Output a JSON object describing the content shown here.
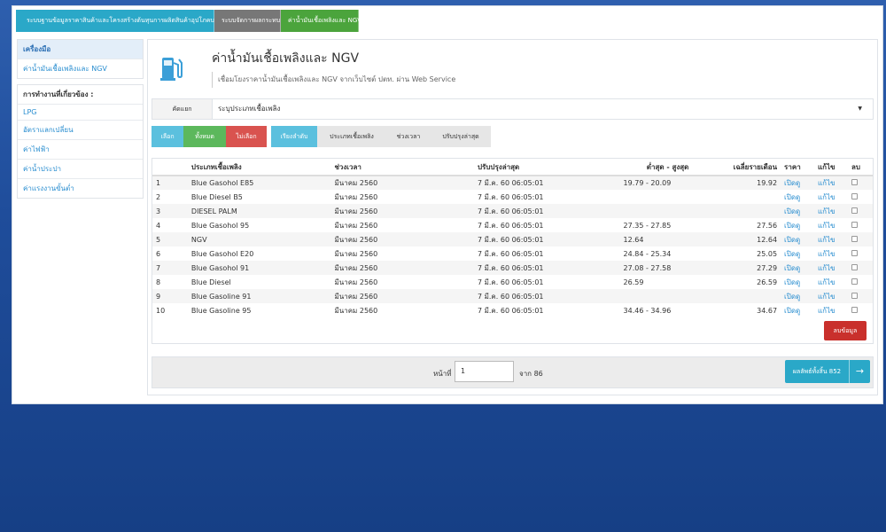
{
  "topnav": {
    "tabs": [
      {
        "label": "ระบบฐานข้อมูลราคาสินค้าและโครงสร้างต้นทุนการผลิตสินค้าอุปโภคบริโภค"
      },
      {
        "label": "ระบบจัดการผลกระทบ"
      },
      {
        "label": "ค่าน้ำมันเชื้อเพลิงและ NGV"
      }
    ]
  },
  "sidebar": {
    "tools_title": "เครื่องมือ",
    "tools_items": [
      "ค่าน้ำมันเชื้อเพลิงและ NGV"
    ],
    "related_title": "การทำงานที่เกี่ยวข้อง :",
    "related_items": [
      "LPG",
      "อัตราแลกเปลี่ยน",
      "ค่าไฟฟ้า",
      "ค่าน้ำประปา",
      "ค่าแรงงานขั้นต่ำ"
    ]
  },
  "main": {
    "title": "ค่าน้ำมันเชื้อเพลิงและ NGV",
    "subtitle": "เชื่อมโยงราคาน้ำมันเชื้อเพลิงและ NGV จากเว็บไซต์ ปตท. ผ่าน Web Service",
    "filter_label": "คัดแยก",
    "filter_value": "ระบุประเภทเชื้อเพลิง",
    "buttons": {
      "select": "เลือก",
      "all": "ทั้งหมด",
      "none": "ไม่เลือก",
      "sort": "เรียงลำดับ",
      "type": "ประเภทเชื้อเพลิง",
      "period": "ช่วงเวลา",
      "updated": "ปรับปรุงล่าสุด"
    },
    "delete_label": "ลบข้อมูล"
  },
  "table": {
    "headers": {
      "no": "",
      "type": "ประเภทเชื้อเพลิง",
      "period": "ช่วงเวลา",
      "updated": "ปรับปรุงล่าสุด",
      "range": "ต่ำสุด - สูงสุด",
      "avg": "เฉลี่ยรายเดือน",
      "price": "ราคา",
      "edit": "แก้ไข",
      "delete": "ลบ"
    },
    "rows": [
      {
        "no": "1",
        "type": "Blue Gasohol E85",
        "period": "มีนาคม 2560",
        "updated": "7 มี.ค. 60 06:05:01",
        "range": "19.79 - 20.09",
        "avg": "19.92",
        "price": "เปิดดู",
        "edit": "แก้ไข"
      },
      {
        "no": "2",
        "type": "Blue Diesel B5",
        "period": "มีนาคม 2560",
        "updated": "7 มี.ค. 60 06:05:01",
        "range": "",
        "avg": "",
        "price": "เปิดดู",
        "edit": "แก้ไข"
      },
      {
        "no": "3",
        "type": "DIESEL PALM",
        "period": "มีนาคม 2560",
        "updated": "7 มี.ค. 60 06:05:01",
        "range": "",
        "avg": "",
        "price": "เปิดดู",
        "edit": "แก้ไข"
      },
      {
        "no": "4",
        "type": "Blue Gasohol 95",
        "period": "มีนาคม 2560",
        "updated": "7 มี.ค. 60 06:05:01",
        "range": "27.35 - 27.85",
        "avg": "27.56",
        "price": "เปิดดู",
        "edit": "แก้ไข"
      },
      {
        "no": "5",
        "type": "NGV",
        "period": "มีนาคม 2560",
        "updated": "7 มี.ค. 60 06:05:01",
        "range": "12.64",
        "avg": "12.64",
        "price": "เปิดดู",
        "edit": "แก้ไข"
      },
      {
        "no": "6",
        "type": "Blue Gasohol E20",
        "period": "มีนาคม 2560",
        "updated": "7 มี.ค. 60 06:05:01",
        "range": "24.84 - 25.34",
        "avg": "25.05",
        "price": "เปิดดู",
        "edit": "แก้ไข"
      },
      {
        "no": "7",
        "type": "Blue Gasohol 91",
        "period": "มีนาคม 2560",
        "updated": "7 มี.ค. 60 06:05:01",
        "range": "27.08 - 27.58",
        "avg": "27.29",
        "price": "เปิดดู",
        "edit": "แก้ไข"
      },
      {
        "no": "8",
        "type": "Blue Diesel",
        "period": "มีนาคม 2560",
        "updated": "7 มี.ค. 60 06:05:01",
        "range": "26.59",
        "avg": "26.59",
        "price": "เปิดดู",
        "edit": "แก้ไข"
      },
      {
        "no": "9",
        "type": "Blue Gasoline 91",
        "period": "มีนาคม 2560",
        "updated": "7 มี.ค. 60 06:05:01",
        "range": "",
        "avg": "",
        "price": "เปิดดู",
        "edit": "แก้ไข"
      },
      {
        "no": "10",
        "type": "Blue Gasoline 95",
        "period": "มีนาคม 2560",
        "updated": "7 มี.ค. 60 06:05:01",
        "range": "34.46 - 34.96",
        "avg": "34.67",
        "price": "เปิดดู",
        "edit": "แก้ไข"
      }
    ]
  },
  "pager": {
    "page_label": "หน้าที่",
    "page_value": "1",
    "of_label": "จาก 86",
    "next_label": "ผลลัพธ์ทั้งสิ้น 852"
  }
}
